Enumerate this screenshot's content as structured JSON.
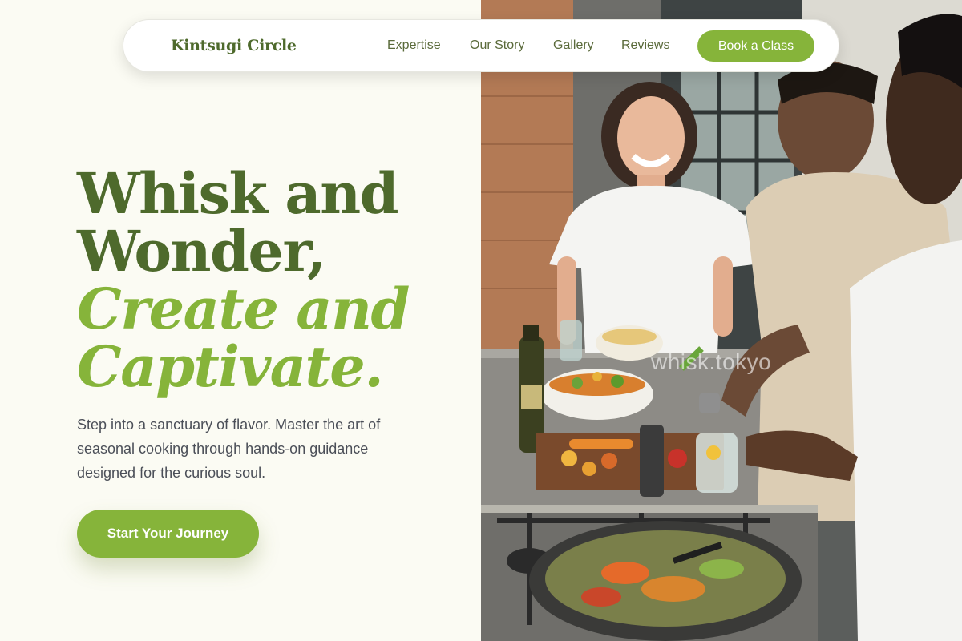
{
  "brand": {
    "name": "Kintsugi Circle"
  },
  "nav": {
    "links": [
      "Expertise",
      "Our Story",
      "Gallery",
      "Reviews"
    ],
    "cta_label": "Book a Class"
  },
  "hero": {
    "headline_line1": "Whisk and",
    "headline_line2": "Wonder,",
    "headline_accent_line1": "Create and",
    "headline_accent_line2": "Captivate.",
    "subtext": "Step into a sanctuary of flavor. Master the art of seasonal cooking through hands-on guidance designed for the curious soul.",
    "cta_label": "Start Your Journey"
  },
  "photo": {
    "watermark": "whisk.tokyo"
  },
  "colors": {
    "primary_dark": "#4e6a2c",
    "accent_green": "#86b43a",
    "background": "#fbfbf3",
    "body_text": "#4b4f58"
  }
}
